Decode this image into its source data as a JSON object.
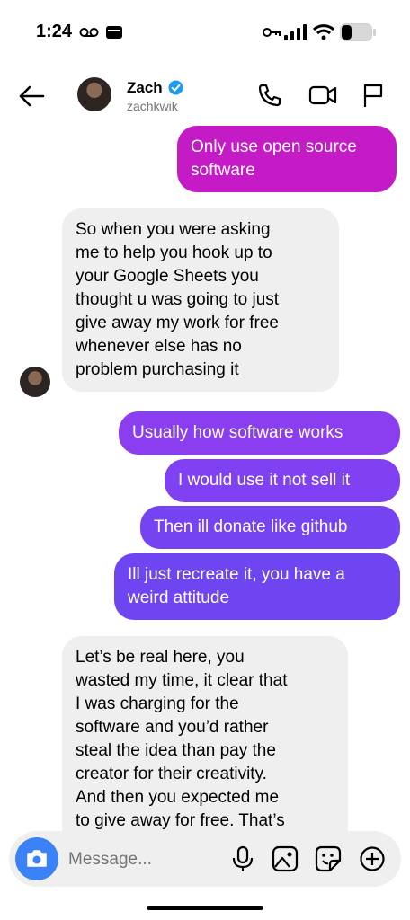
{
  "status": {
    "time": "1:24"
  },
  "header": {
    "name": "Zach",
    "handle": "zachkwik"
  },
  "messages": [
    {
      "side": "out",
      "text": "Only use open source\nsoftware"
    },
    {
      "side": "in",
      "text": "So when you were asking\nme to help you hook up to\nyour Google Sheets you\nthought u was going to just\ngive away my work for free\nwhenever else has no\nproblem purchasing it"
    },
    {
      "side": "out",
      "text": "Usually how software works"
    },
    {
      "side": "out",
      "text": "I would use it not sell it"
    },
    {
      "side": "out",
      "text": "Then ill donate like github"
    },
    {
      "side": "out",
      "text": "Ill just recreate it, you have a\nweird attitude"
    },
    {
      "side": "in",
      "text": "Let’s be real here, you\nwasted my time, it clear that\nI was charging for the\nsoftware and you’d rather\nsteal the idea than pay the\ncreator for their creativity.\nAnd then you expected me\nto give away for free. That’s"
    }
  ],
  "composer": {
    "placeholder": "Message..."
  },
  "colors": {
    "out_top": "#c41bc6",
    "out_mid": "#8a3ef0",
    "out_bottom": "#6f45f2",
    "incoming": "#efefef",
    "camera": "#3b82f6",
    "verified": "#1d9bf0"
  },
  "icons": [
    "voicemail-icon",
    "wallet-icon",
    "key-icon",
    "signal-icon",
    "wifi-icon",
    "battery-icon",
    "back-arrow-icon",
    "verified-badge-icon",
    "phone-icon",
    "video-camera-icon",
    "flag-icon",
    "camera-icon",
    "microphone-icon",
    "image-icon",
    "sticker-icon",
    "plus-circle-icon"
  ]
}
